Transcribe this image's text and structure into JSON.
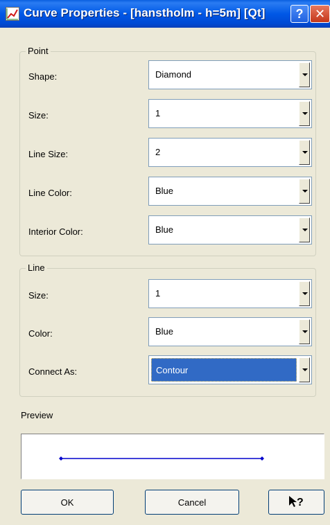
{
  "window": {
    "title": "Curve Properties - [hanstholm - h=5m] [Qt]",
    "help_glyph": "?",
    "close_glyph": "✕"
  },
  "point_group": {
    "legend": "Point",
    "fields": [
      {
        "label": "Shape:",
        "value": "Diamond"
      },
      {
        "label": "Size:",
        "value": "1"
      },
      {
        "label": "Line Size:",
        "value": "2"
      },
      {
        "label": "Line Color:",
        "value": "Blue"
      },
      {
        "label": "Interior Color:",
        "value": "Blue"
      }
    ]
  },
  "line_group": {
    "legend": "Line",
    "fields": [
      {
        "label": "Size:",
        "value": "1"
      },
      {
        "label": "Color:",
        "value": "Blue"
      },
      {
        "label": "Connect As:",
        "value": "Contour"
      }
    ]
  },
  "preview": {
    "label": "Preview",
    "curve_color": "#0000cc"
  },
  "buttons": {
    "ok": "OK",
    "cancel": "Cancel",
    "whats_this": "N?"
  },
  "colors": {
    "title_bar": "#0058e6",
    "selection": "#316ac5",
    "dialog_bg": "#ece9d8"
  }
}
